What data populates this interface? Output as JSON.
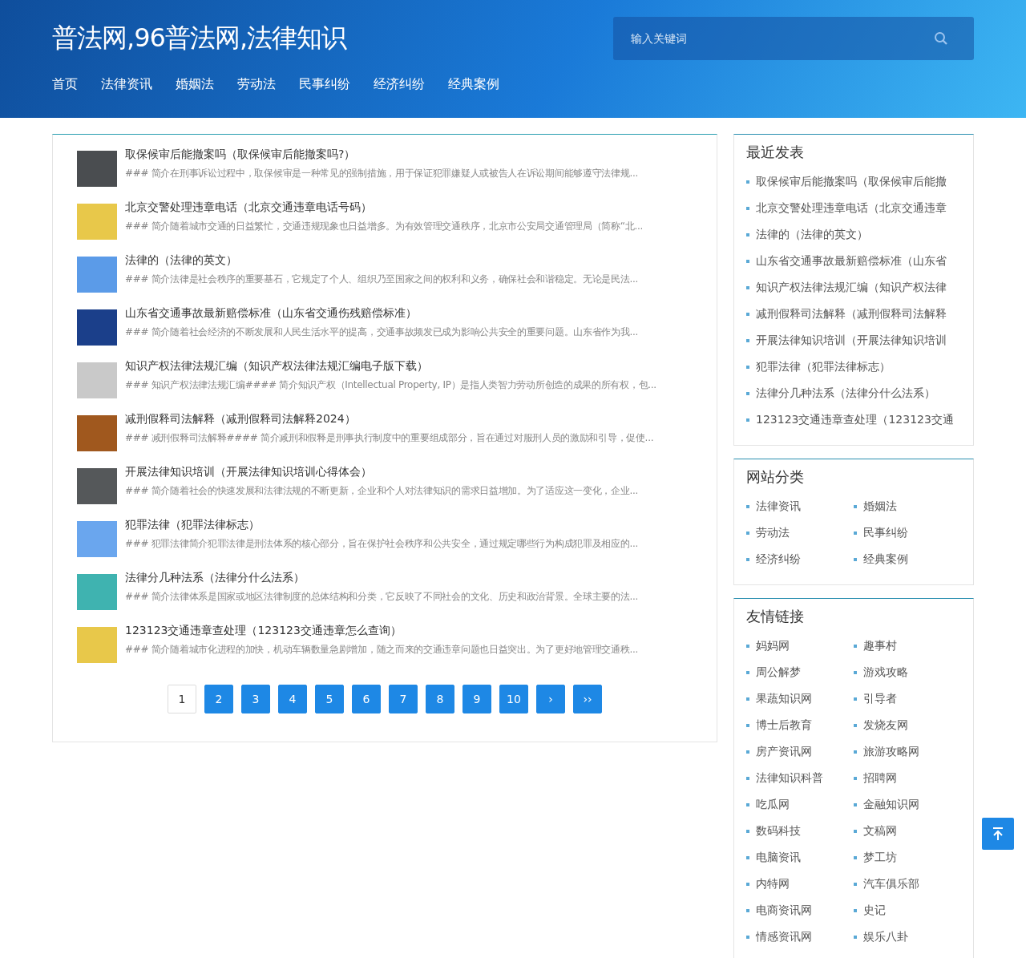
{
  "header": {
    "site_title": "普法网,96普法网,法律知识",
    "search": {
      "placeholder": "输入关键词"
    },
    "nav": [
      "首页",
      "法律资讯",
      "婚姻法",
      "劳动法",
      "民事纠纷",
      "经济纠纷",
      "经典案例"
    ]
  },
  "articles": [
    {
      "title": "取保候审后能撤案吗（取保候审后能撤案吗?）",
      "summary": "### 简介在刑事诉讼过程中，取保候审是一种常见的强制措施，用于保证犯罪嫌疑人或被告人在诉讼期间能够遵守法律规...",
      "color": "#4a4d50"
    },
    {
      "title": "北京交警处理违章电话（北京交通违章电话号码）",
      "summary": "### 简介随着城市交通的日益繁忙，交通违规现象也日益增多。为有效管理交通秩序，北京市公安局交通管理局（简称“北...",
      "color": "#e8c84a"
    },
    {
      "title": "法律的（法律的英文）",
      "summary": "### 简介法律是社会秩序的重要基石，它规定了个人、组织乃至国家之间的权利和义务，确保社会和谐稳定。无论是民法...",
      "color": "#5b9be8"
    },
    {
      "title": "山东省交通事故最新赔偿标准（山东省交通伤残赔偿标准）",
      "summary": "### 简介随着社会经济的不断发展和人民生活水平的提高，交通事故频发已成为影响公共安全的重要问题。山东省作为我...",
      "color": "#1b3f8a"
    },
    {
      "title": "知识产权法律法规汇编（知识产权法律法规汇编电子版下载）",
      "summary": "### 知识产权法律法规汇编#### 简介知识产权（Intellectual Property, IP）是指人类智力劳动所创造的成果的所有权，包...",
      "color": "#c9c9c9"
    },
    {
      "title": "减刑假释司法解释（减刑假释司法解释2024）",
      "summary": "### 减刑假释司法解释#### 简介减刑和假释是刑事执行制度中的重要组成部分，旨在通过对服刑人员的激励和引导，促使...",
      "color": "#a0581e"
    },
    {
      "title": "开展法律知识培训（开展法律知识培训心得体会）",
      "summary": "### 简介随着社会的快速发展和法律法规的不断更新，企业和个人对法律知识的需求日益增加。为了适应这一变化，企业...",
      "color": "#55585a"
    },
    {
      "title": "犯罪法律（犯罪法律标志）",
      "summary": "### 犯罪法律简介犯罪法律是刑法体系的核心部分，旨在保护社会秩序和公共安全，通过规定哪些行为构成犯罪及相应的...",
      "color": "#6aa6ee"
    },
    {
      "title": "法律分几种法系（法律分什么法系）",
      "summary": "### 简介法律体系是国家或地区法律制度的总体结构和分类，它反映了不同社会的文化、历史和政治背景。全球主要的法...",
      "color": "#3fb3b0"
    },
    {
      "title": "123123交通违章查处理（123123交通违章怎么查询）",
      "summary": "### 简介随着城市化进程的加快，机动车辆数量急剧增加，随之而来的交通违章问题也日益突出。为了更好地管理交通秩...",
      "color": "#e8c84a"
    }
  ],
  "pagination": [
    {
      "label": "1",
      "selected": true
    },
    {
      "label": "2",
      "selected": false
    },
    {
      "label": "3",
      "selected": false
    },
    {
      "label": "4",
      "selected": false
    },
    {
      "label": "5",
      "selected": false
    },
    {
      "label": "6",
      "selected": false
    },
    {
      "label": "7",
      "selected": false
    },
    {
      "label": "8",
      "selected": false
    },
    {
      "label": "9",
      "selected": false
    },
    {
      "label": "10",
      "selected": false
    },
    {
      "label": "›",
      "selected": false
    },
    {
      "label": "››",
      "selected": false
    }
  ],
  "sidebar": {
    "recent": {
      "title": "最近发表",
      "items": [
        "取保候审后能撤案吗（取保候审后能撤",
        "北京交警处理违章电话（北京交通违章",
        "法律的（法律的英文）",
        "山东省交通事故最新赔偿标准（山东省",
        "知识产权法律法规汇编（知识产权法律",
        "减刑假释司法解释（减刑假释司法解释",
        "开展法律知识培训（开展法律知识培训",
        "犯罪法律（犯罪法律标志）",
        "法律分几种法系（法律分什么法系）",
        "123123交通违章查处理（123123交通"
      ]
    },
    "categories": {
      "title": "网站分类",
      "items": [
        "法律资讯",
        "婚姻法",
        "劳动法",
        "民事纠纷",
        "经济纠纷",
        "经典案例"
      ]
    },
    "links": {
      "title": "友情链接",
      "items": [
        "妈妈网",
        "趣事村",
        "周公解梦",
        "游戏攻略",
        "果蔬知识网",
        "引导者",
        "博士后教育",
        "发烧友网",
        "房产资讯网",
        "旅游攻略网",
        "法律知识科普",
        "招聘网",
        "吃瓜网",
        "金融知识网",
        "数码科技",
        "文稿网",
        "电脑资讯",
        "梦工坊",
        "内特网",
        "汽车俱乐部",
        "电商资讯网",
        "史记",
        "情感资讯网",
        "娱乐八卦"
      ]
    }
  }
}
